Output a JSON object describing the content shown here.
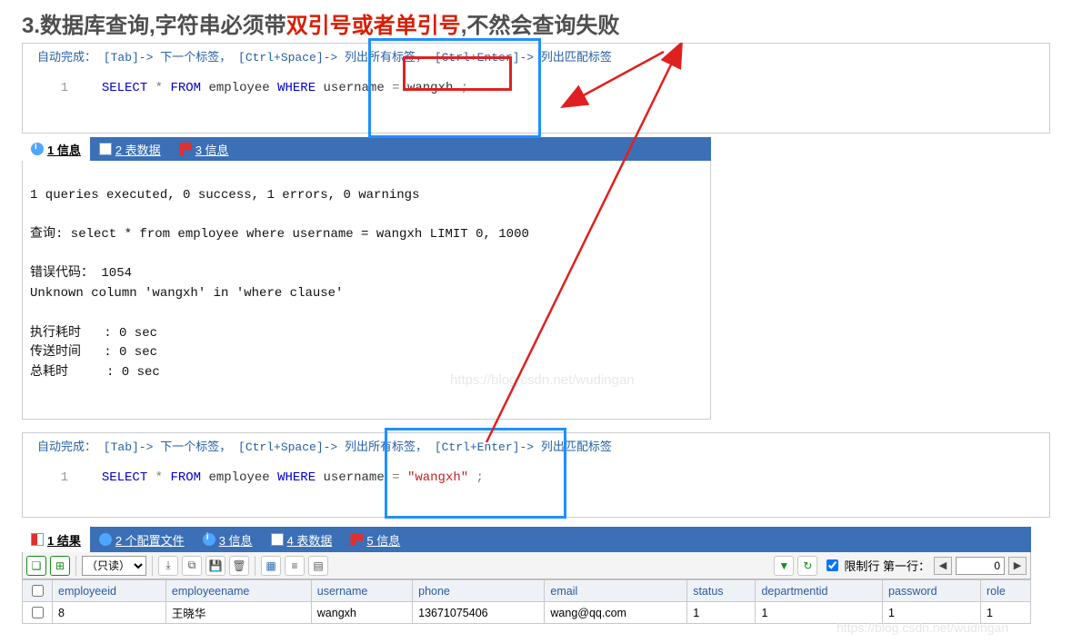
{
  "title": {
    "prefix": "3.数据库查询,字符串必须带",
    "highlight": "双引号或者单引号",
    "suffix": ",不然会查询失败"
  },
  "editor1": {
    "hint": "自动完成： [Tab]-> 下一个标签， [Ctrl+Space]-> 列出所有标签， [Ctrl+Enter]-> 列出匹配标签",
    "line_no": "1",
    "sql_select": "SELECT",
    "sql_star": " * ",
    "sql_from": "FROM",
    "sql_table": " employee ",
    "sql_where": "WHERE",
    "sql_col": " username ",
    "sql_eq": "= ",
    "sql_val": "wangxh",
    "sql_end": " ;"
  },
  "tabs_mid": {
    "t1": "1 信息",
    "t2": "2 表数据",
    "t3": "3 信息"
  },
  "output": {
    "l1": "1 queries executed, 0 success, 1 errors, 0 warnings",
    "l2": "查询: select * from employee where username = wangxh LIMIT 0, 1000",
    "l3": "错误代码： 1054",
    "l4": "Unknown column 'wangxh' in 'where clause'",
    "l5": "执行耗时   : 0 sec",
    "l6": "传送时间   : 0 sec",
    "l7": "总耗时     : 0 sec",
    "watermark": "https://blog.csdn.net/wudingan"
  },
  "editor2": {
    "hint": "自动完成： [Tab]-> 下一个标签， [Ctrl+Space]-> 列出所有标签， [Ctrl+Enter]-> 列出匹配标签",
    "line_no": "1",
    "sql_select": "SELECT",
    "sql_star": " * ",
    "sql_from": "FROM",
    "sql_table": " employee ",
    "sql_where": "WHERE",
    "sql_col": " username ",
    "sql_eq": "= ",
    "sql_val": "\"wangxh\"",
    "sql_end": " ;"
  },
  "tabs_bot": {
    "t1": "1 结果",
    "t2": "2 个配置文件",
    "t3": "3 信息",
    "t4": "4 表数据",
    "t5": "5 信息"
  },
  "toolbar": {
    "readonly": "（只读）",
    "limit_label": "限制行  第一行：",
    "first_row": "0"
  },
  "table": {
    "headers": [
      "employeeid",
      "employeename",
      "username",
      "phone",
      "email",
      "status",
      "departmentid",
      "password",
      "role"
    ],
    "row": {
      "employeeid": "8",
      "employeename": "王晓华",
      "username": "wangxh",
      "phone": "13671075406",
      "email": "wang@qq.com",
      "status": "1",
      "departmentid": "1",
      "password": "1",
      "role": "1"
    }
  },
  "watermark2": "https://blog.csdn.net/wudingan"
}
